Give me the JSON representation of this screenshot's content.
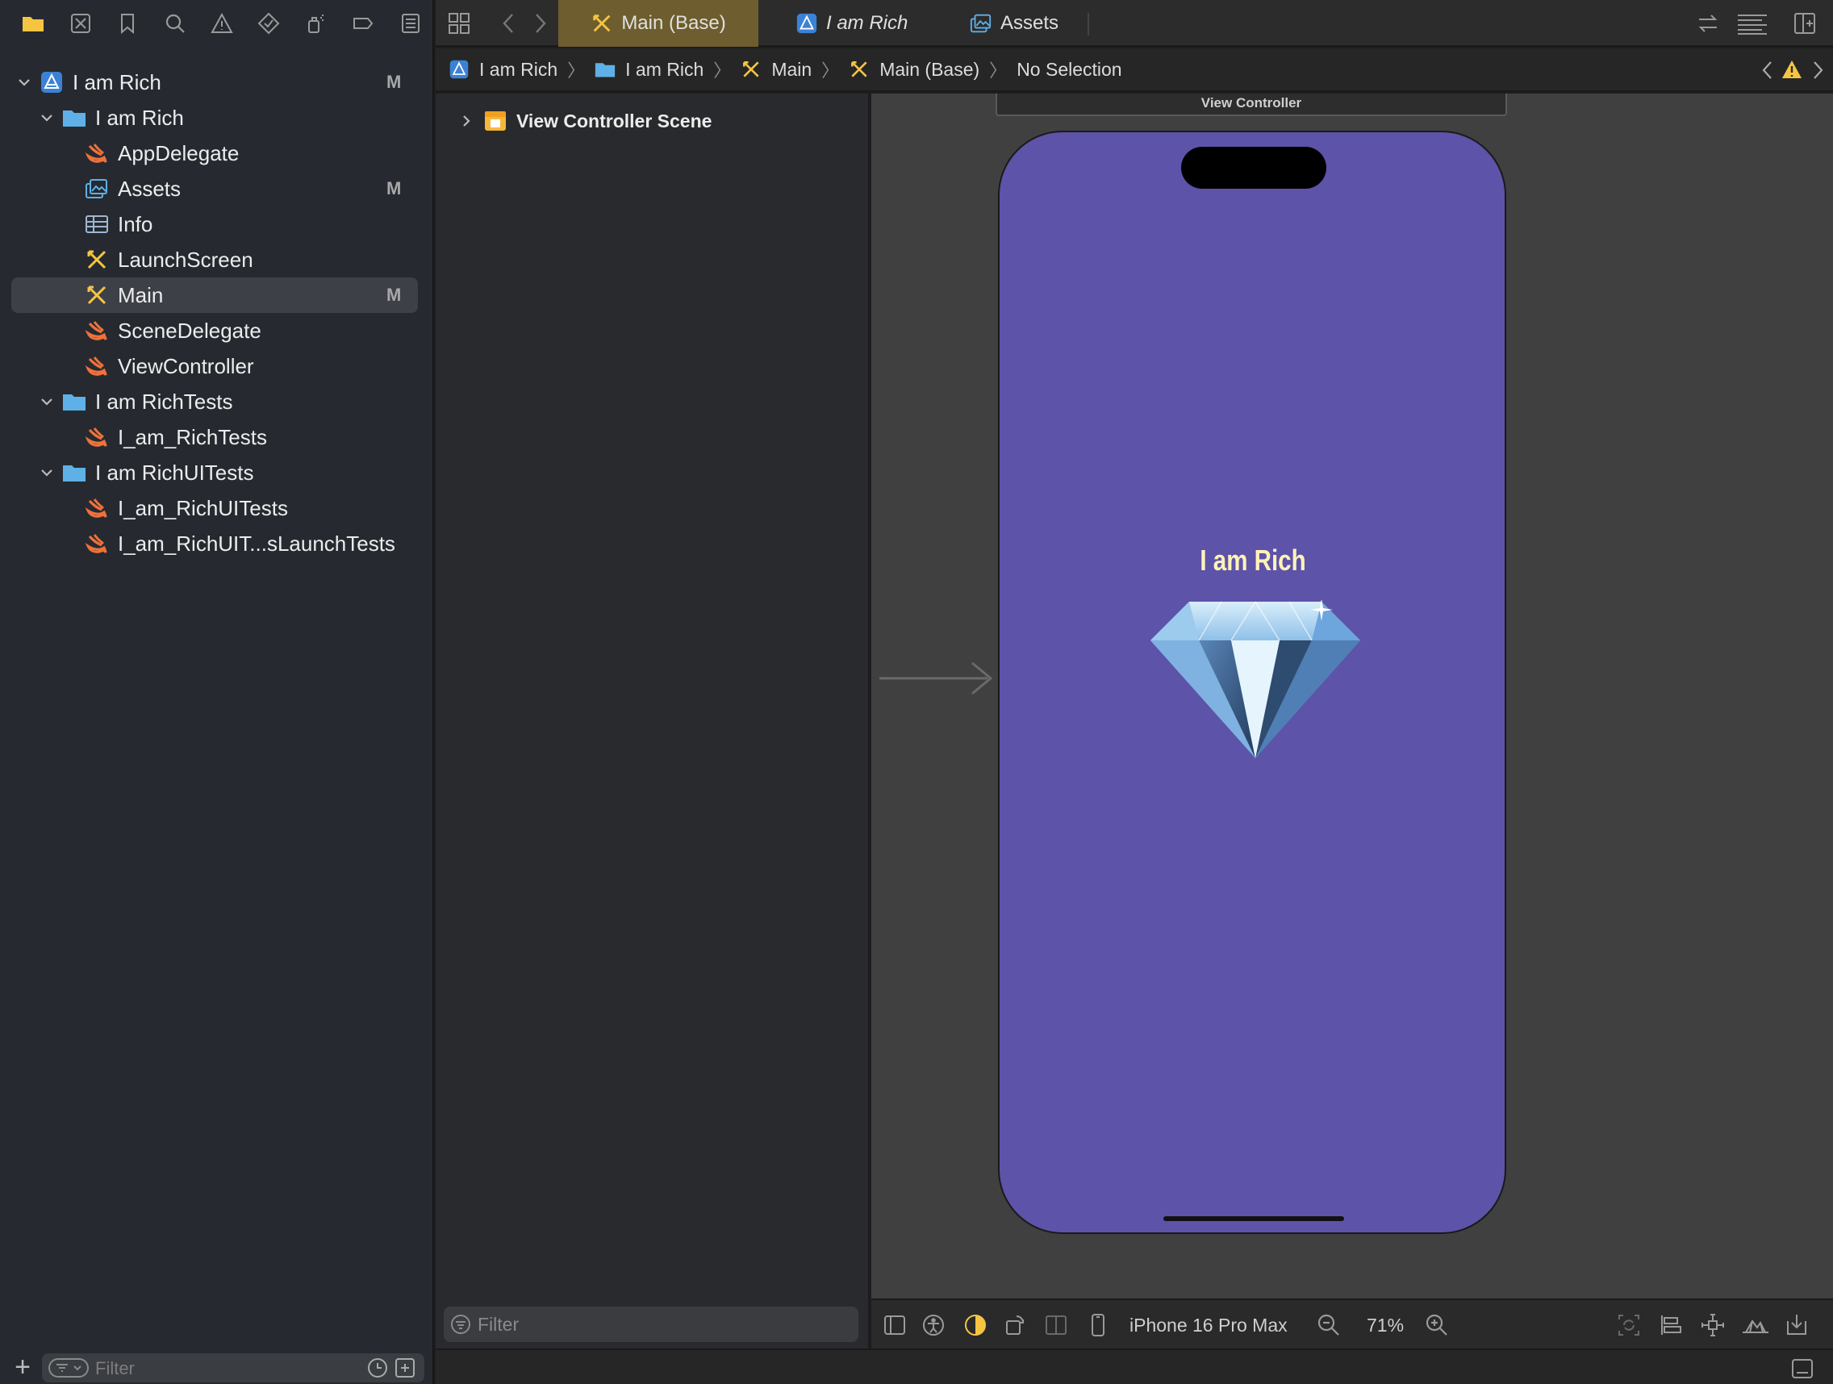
{
  "navigator": {
    "tree": [
      {
        "label": "I am Rich",
        "type": "project",
        "level": 0,
        "expanded": true,
        "status": "M"
      },
      {
        "label": "I am Rich",
        "type": "folder",
        "level": 1,
        "expanded": true,
        "status": ""
      },
      {
        "label": "AppDelegate",
        "type": "swift",
        "level": 2,
        "status": ""
      },
      {
        "label": "Assets",
        "type": "assets",
        "level": 2,
        "status": "M"
      },
      {
        "label": "Info",
        "type": "plist",
        "level": 2,
        "status": ""
      },
      {
        "label": "LaunchScreen",
        "type": "storyboard",
        "level": 2,
        "status": ""
      },
      {
        "label": "Main",
        "type": "storyboard",
        "level": 2,
        "status": "M",
        "selected": true
      },
      {
        "label": "SceneDelegate",
        "type": "swift",
        "level": 2,
        "status": ""
      },
      {
        "label": "ViewController",
        "type": "swift",
        "level": 2,
        "status": ""
      },
      {
        "label": "I am RichTests",
        "type": "folder",
        "level": 1,
        "expanded": true,
        "status": ""
      },
      {
        "label": "I_am_RichTests",
        "type": "swift",
        "level": 2,
        "status": ""
      },
      {
        "label": "I am RichUITests",
        "type": "folder",
        "level": 1,
        "expanded": true,
        "status": ""
      },
      {
        "label": "I_am_RichUITests",
        "type": "swift",
        "level": 2,
        "status": ""
      },
      {
        "label": "I_am_RichUIT...sLaunchTests",
        "type": "swift",
        "level": 2,
        "status": ""
      }
    ],
    "filter_placeholder": "Filter"
  },
  "tabs": [
    {
      "label": "Main (Base)",
      "active": true
    },
    {
      "label": "I am Rich",
      "active": false
    },
    {
      "label": "Assets",
      "active": false
    }
  ],
  "jumpbar": {
    "crumbs": [
      "I am Rich",
      "I am Rich",
      "Main",
      "Main (Base)",
      "No Selection"
    ]
  },
  "outline": {
    "scene_label": "View Controller Scene",
    "filter_placeholder": "Filter"
  },
  "canvas": {
    "scene_title": "View Controller",
    "app_title": "I am Rich",
    "background_color": "#5d53a9",
    "title_color": "#fff3b8"
  },
  "devicebar": {
    "device": "iPhone 16 Pro Max",
    "zoom": "71%"
  },
  "colors": {
    "swift": "#f0713a",
    "folder": "#5fb0e6",
    "storyboard": "#f5c542",
    "active_tab": "#6e5d2e",
    "warning": "#f5c542"
  }
}
